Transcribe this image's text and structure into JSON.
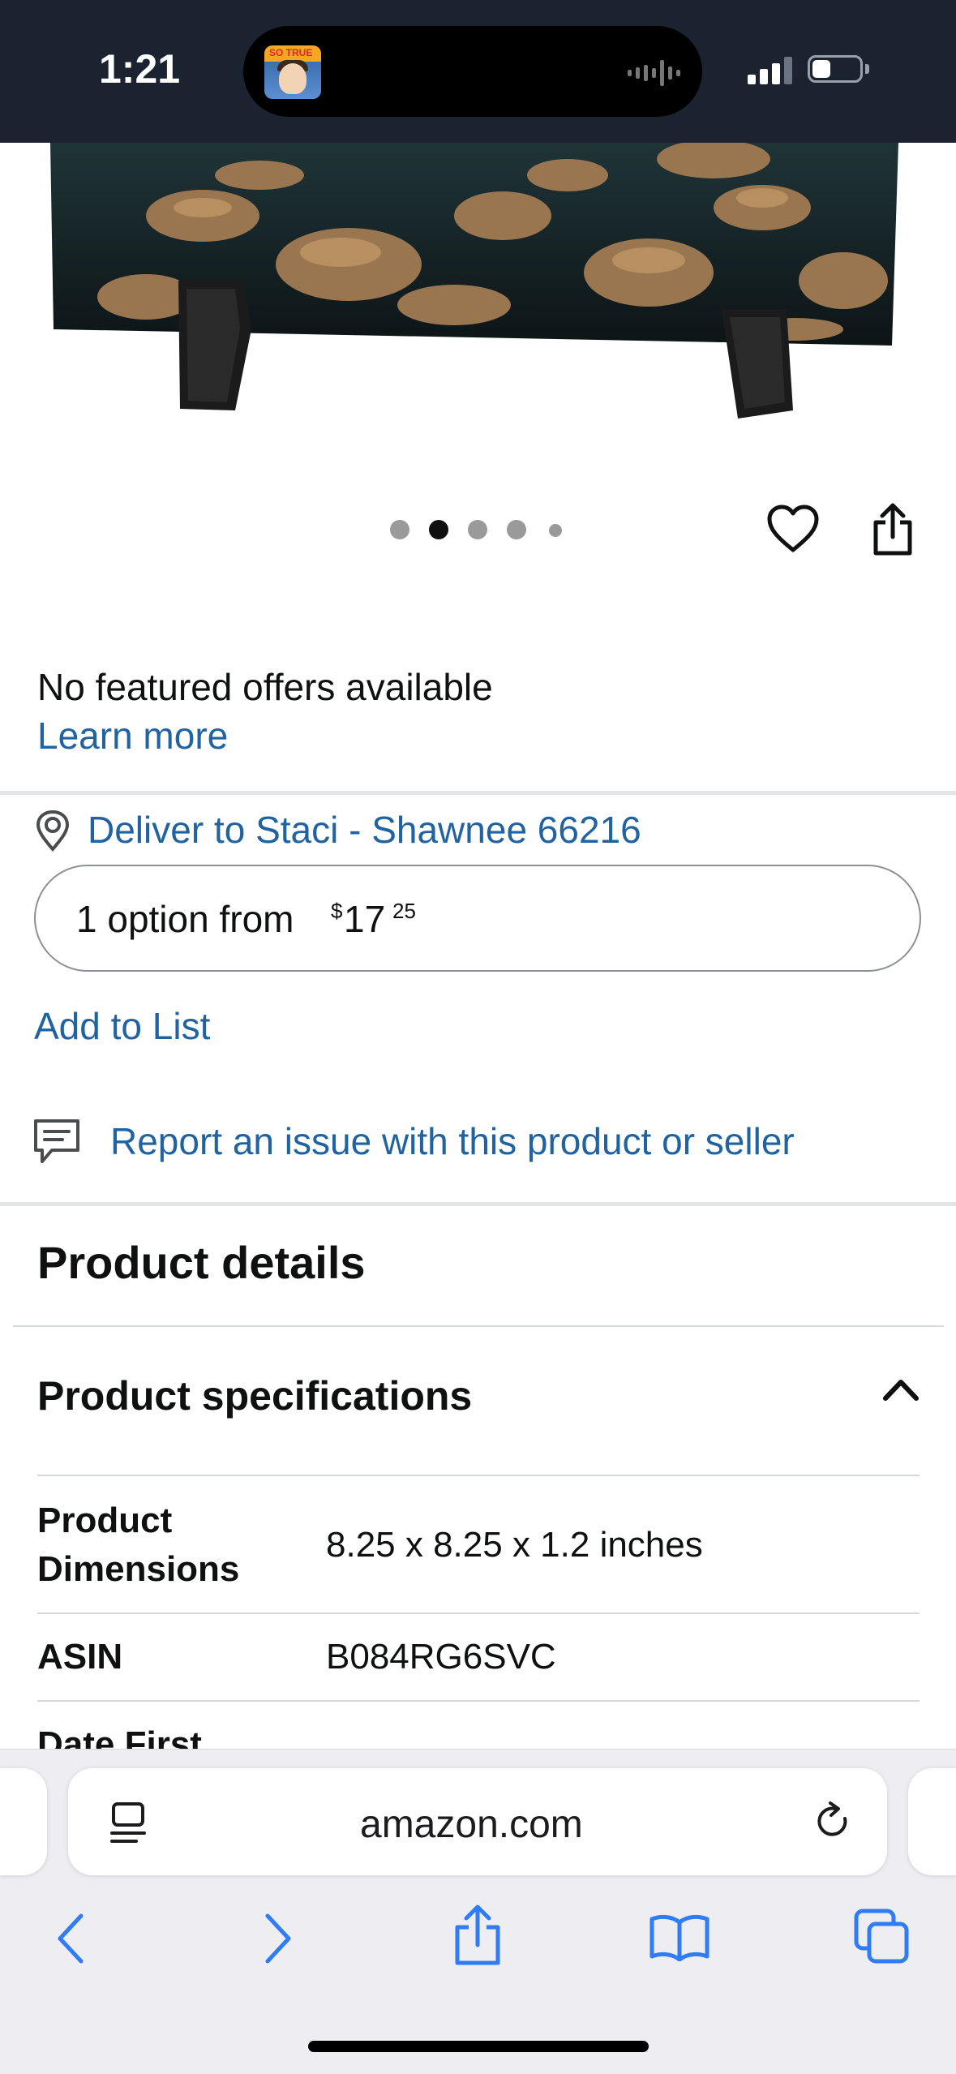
{
  "status_bar": {
    "time": "1:21",
    "island_sticker": "SO TRUE"
  },
  "carousel": {
    "count": 5,
    "active_index": 1
  },
  "offers": {
    "no_offers_text": "No featured offers available",
    "learn_more": "Learn more"
  },
  "delivery": {
    "deliver_to": "Deliver to Staci - Shawnee 66216"
  },
  "price_option": {
    "label": "1 option from",
    "currency": "$",
    "whole": "17",
    "fraction": "25"
  },
  "add_to_list": "Add to List",
  "report": "Report an issue with this product or seller",
  "details": {
    "title": "Product details",
    "specs_title": "Product specifications",
    "specs_expanded": true,
    "specs": [
      {
        "label_line1": "Product",
        "label_line2": "Dimensions",
        "value": "8.25 x 8.25 x 1.2 inches"
      },
      {
        "label_line1": "ASIN",
        "label_line2": "",
        "value": "B084RG6SVC"
      },
      {
        "label_line1": "Date First",
        "label_line2": "",
        "value": ""
      }
    ]
  },
  "browser": {
    "url": "amazon.com"
  },
  "colors": {
    "link": "#2162a1",
    "status_bar_bg": "#1b2230",
    "chrome_bg": "#eeedf2",
    "ios_blue": "#2f7cf6"
  }
}
